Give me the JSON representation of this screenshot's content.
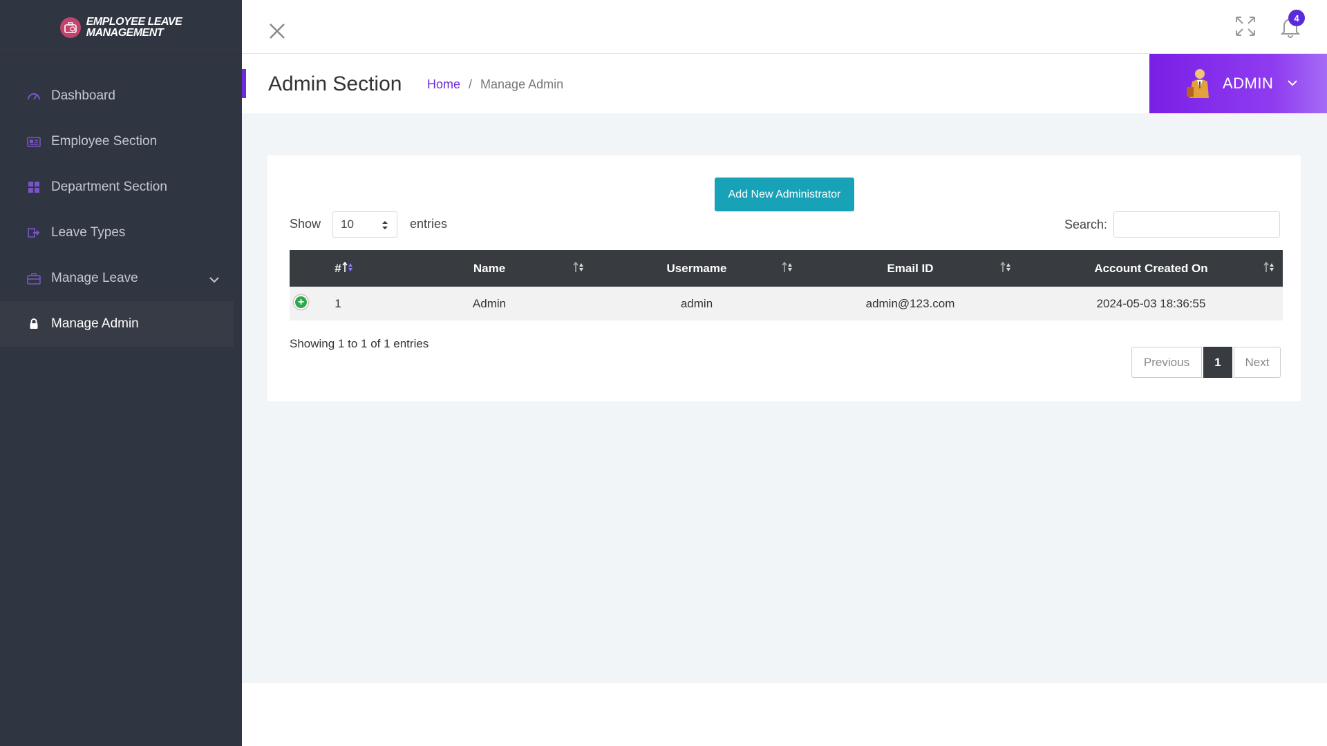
{
  "brand": {
    "line1": "Employee Leave",
    "line2": "Management"
  },
  "sidebar": {
    "items": [
      {
        "label": "Dashboard",
        "icon": "dashboard-icon"
      },
      {
        "label": "Employee Section",
        "icon": "id-card-icon"
      },
      {
        "label": "Department Section",
        "icon": "grid-icon"
      },
      {
        "label": "Leave Types",
        "icon": "sign-out-icon"
      },
      {
        "label": "Manage Leave",
        "icon": "briefcase-icon"
      },
      {
        "label": "Manage Admin",
        "icon": "lock-icon"
      }
    ]
  },
  "topbar": {
    "notification_count": "4"
  },
  "header": {
    "title": "Admin Section",
    "breadcrumb": {
      "home": "Home",
      "separator": "/",
      "current": "Manage Admin"
    },
    "user": "ADMIN"
  },
  "colors": {
    "accent": "#6c2bd9",
    "sidebar": "#303641",
    "button": "#17a2b8",
    "table_header": "#383c41"
  },
  "controls": {
    "add_button": "Add New Administrator",
    "show_label": "Show",
    "page_size": "10",
    "entries_label": "entries",
    "search_label": "Search:"
  },
  "table": {
    "headers": [
      "#",
      "Name",
      "Usermame",
      "Email ID",
      "Account Created On"
    ],
    "rows": [
      {
        "num": "1",
        "name": "Admin",
        "username": "admin",
        "email": "admin@123.com",
        "created": "2024-05-03 18:36:55"
      }
    ]
  },
  "footer": {
    "info": "Showing 1 to 1 of 1 entries",
    "prev": "Previous",
    "page": "1",
    "next": "Next"
  }
}
